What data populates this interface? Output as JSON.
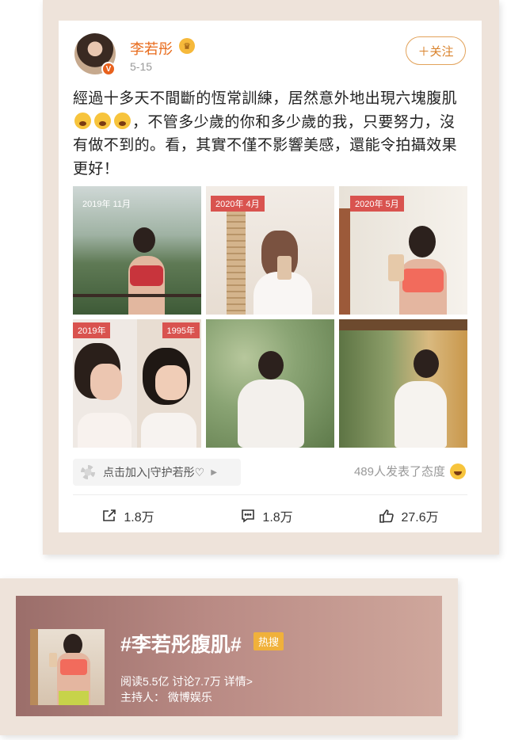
{
  "post": {
    "username": "李若彤",
    "date": "5-15",
    "follow_label": "＋关注",
    "text_parts": [
      "經過十多天不間斷的恆常訓練，居然意外地出現六塊腹肌",
      "，不管多少歲的你和多少歲的我，只要努力，沒有做不到的。看，其實不僅不影響美感，還能令拍攝效果更好！"
    ],
    "verified_badge": "V",
    "vip_icon": "crown-icon",
    "images": [
      {
        "tag": "2019年 11月"
      },
      {
        "tag": "2020年 4月"
      },
      {
        "tag": "2020年 5月"
      },
      {
        "tag_left": "2019年",
        "tag_right": "1995年"
      },
      {
        "tag": ""
      },
      {
        "tag": ""
      }
    ],
    "supertopic_label": "点击加入|守护若彤♡",
    "attitude_text": "489人发表了态度",
    "actions": {
      "share": "1.8万",
      "comment": "1.8万",
      "like": "27.6万"
    }
  },
  "topic": {
    "title": "#李若彤腹肌#",
    "hot_badge": "热搜",
    "stats": "阅读5.5亿  讨论7.7万  详情>",
    "host": "主持人：  微博娱乐"
  },
  "colors": {
    "accent": "#e86b1c",
    "frame": "#eee3da",
    "hot": "#f0b13b"
  }
}
